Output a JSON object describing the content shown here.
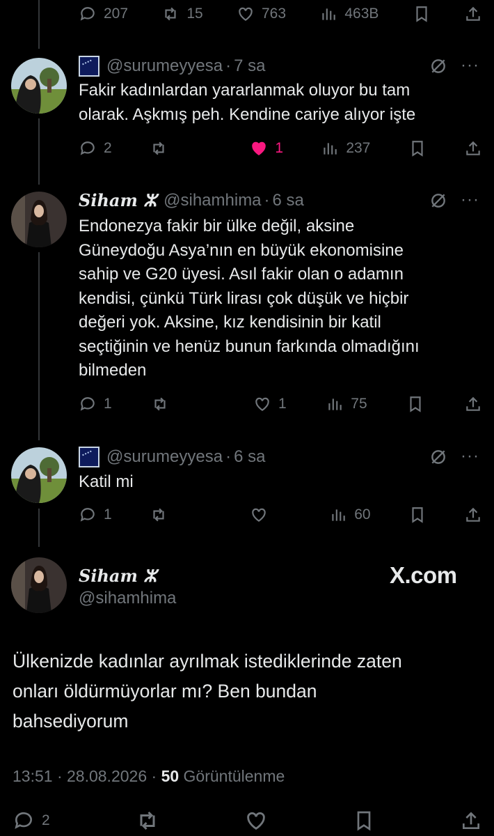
{
  "prev_tweet_actions": {
    "replies": "207",
    "reposts": "15",
    "likes": "763",
    "views": "463B"
  },
  "tweet1": {
    "handle": "@surumeyyesa",
    "time": "7 sa",
    "text_l1": "Fakir kadınlardan yararlanmak oluyor bu tam",
    "text_l2": "olarak. Aşkmış peh. Kendine cariye alıyor işte",
    "replies": "2",
    "likes": "1",
    "views": "237",
    "like_color": "#f91880"
  },
  "tweet2": {
    "name": "Siham ⵣ",
    "handle": "@sihamhima",
    "time": "6 sa",
    "lines": [
      "Endonezya fakir bir ülke değil, aksine",
      "Güneydoğu Asya’nın en büyük ekonomisine",
      "sahip ve G20 üyesi. Asıl fakir olan o adamın",
      "kendisi, çünkü Türk lirası çok düşük ve hiçbir",
      "değeri yok. Aksine, kız kendisinin bir katil",
      "seçtiğinin ve henüz bunun farkında olmadığını",
      "bilmeden"
    ],
    "replies": "1",
    "likes": "1",
    "views": "75"
  },
  "tweet3": {
    "handle": "@surumeyyesa",
    "time": "6 sa",
    "text": "Katil mi",
    "replies": "1",
    "views": "60"
  },
  "main_tweet": {
    "name": "Siham ⵣ",
    "handle": "@sihamhima",
    "brand": "X.com",
    "lines": [
      "Ülkenizde kadınlar ayrılmak istediklerinde zaten",
      "onları öldürmüyorlar mı? Ben bundan",
      "bahsediyorum"
    ],
    "timestamp": "13:51 · 28.08.2026 · ",
    "view_count": "50",
    "view_label": " Görüntülenme",
    "replies": "2"
  },
  "separator": "·",
  "more": "···",
  "colors": {
    "background": "#000000",
    "text": "#e7e9ea",
    "muted": "#71767b",
    "like": "#f91880",
    "line": "#333639"
  },
  "icons": [
    "reply-icon",
    "repost-icon",
    "like-icon",
    "views-icon",
    "bookmark-icon",
    "share-icon",
    "grok-icon",
    "more-icon",
    "flag-icon"
  ]
}
